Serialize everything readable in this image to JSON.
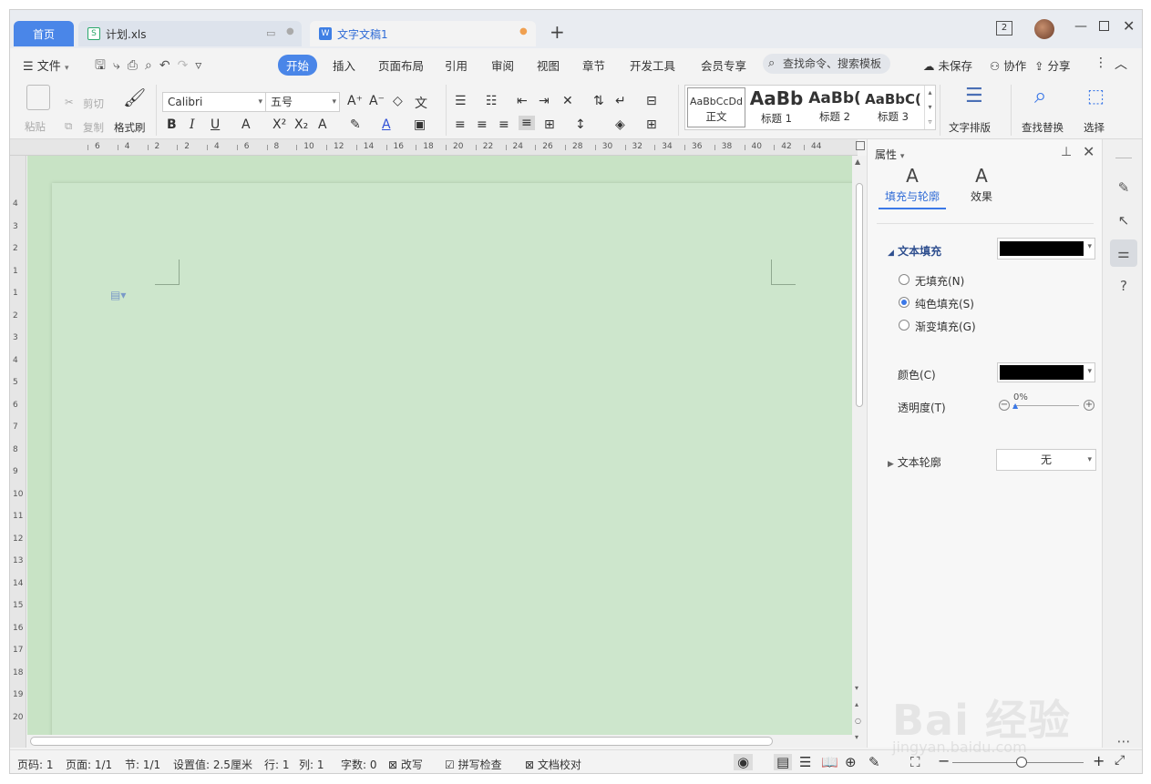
{
  "titlebar": {
    "tab_home": "首页",
    "tab_xls": "计划.xls",
    "tab_doc": "文字文稿1",
    "new_tab": "+",
    "badge": "2"
  },
  "menubar": {
    "file": "文件",
    "items": [
      "开始",
      "插入",
      "页面布局",
      "引用",
      "审阅",
      "视图",
      "章节",
      "开发工具",
      "会员专享"
    ],
    "search": "查找命令、搜索模板",
    "unsaved": "未保存",
    "collab": "协作",
    "share": "分享"
  },
  "ribbon": {
    "paste": "粘贴",
    "cut": "剪切",
    "copy": "复制",
    "format_painter": "格式刷",
    "font_name": "Calibri",
    "font_size": "五号",
    "styles": [
      {
        "preview": "AaBbCcDd",
        "name": "正文"
      },
      {
        "preview": "AaBb",
        "name": "标题 1"
      },
      {
        "preview": "AaBb(",
        "name": "标题 2"
      },
      {
        "preview": "AaBbC(",
        "name": "标题 3"
      }
    ],
    "text_layout": "文字排版",
    "find_replace": "查找替换",
    "select": "选择"
  },
  "ruler": {
    "h_ticks": [
      "6",
      "4",
      "2",
      "2",
      "4",
      "6",
      "8",
      "10",
      "12",
      "14",
      "16",
      "18",
      "20",
      "22",
      "24",
      "26",
      "28",
      "30",
      "32",
      "34",
      "36",
      "38",
      "40",
      "42",
      "44"
    ],
    "v_ticks": [
      "4",
      "3",
      "2",
      "1",
      "1",
      "2",
      "3",
      "4",
      "5",
      "6",
      "7",
      "8",
      "9",
      "10",
      "11",
      "12",
      "13",
      "14",
      "15",
      "16",
      "17",
      "18",
      "19",
      "20"
    ]
  },
  "panel": {
    "title": "属性",
    "tab_fill": "填充与轮廓",
    "tab_effect": "效果",
    "text_fill": "文本填充",
    "opt_none": "无填充(N)",
    "opt_solid": "纯色填充(S)",
    "opt_gradient": "渐变填充(G)",
    "color_label": "颜色(C)",
    "transparency_label": "透明度(T)",
    "transparency_value": "0%",
    "text_outline": "文本轮廓",
    "outline_value": "无",
    "fill_color": "#000000",
    "color_value": "#000000"
  },
  "statusbar": {
    "page_code": "页码: 1",
    "pages": "页面: 1/1",
    "section": "节: 1/1",
    "setting": "设置值: 2.5厘米",
    "row": "行: 1",
    "col": "列: 1",
    "words": "字数: 0",
    "rewrite": "改写",
    "spell": "拼写检查",
    "proof": "文档校对"
  },
  "watermark": {
    "brand": "Bai 经验",
    "url": "jingyan.baidu.com"
  },
  "colors": {
    "accent": "#4a86e8",
    "page_bg": "#cde6cc"
  }
}
